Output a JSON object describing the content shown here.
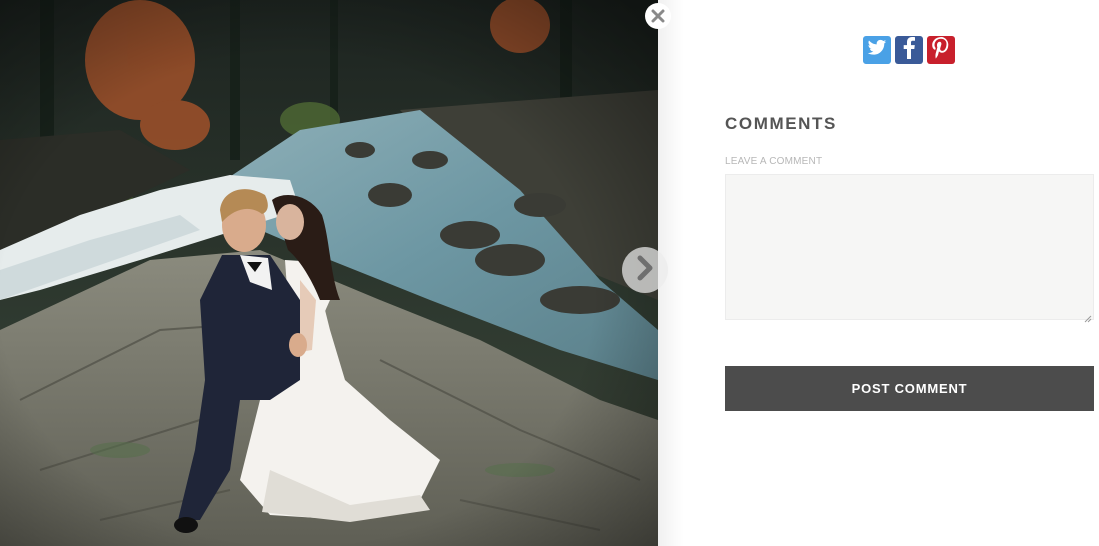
{
  "lightbox": {
    "photo_alt": "Bride and groom kissing on rocks beside a mountain river",
    "close_icon": "close-icon",
    "next_icon": "chevron-right-icon"
  },
  "share": [
    {
      "network": "Twitter",
      "icon": "twitter-icon",
      "color": "#4aa1e6"
    },
    {
      "network": "Facebook",
      "icon": "facebook-icon",
      "color": "#3a5a98"
    },
    {
      "network": "Pinterest",
      "icon": "pinterest-icon",
      "color": "#c8202c"
    }
  ],
  "comments": {
    "title": "COMMENTS",
    "field_label": "LEAVE A COMMENT",
    "field_value": "",
    "submit_label": "POST COMMENT"
  },
  "colors": {
    "button_bg": "#4c4c4c",
    "title_text": "#555555",
    "field_bg": "#f6f6f5"
  }
}
